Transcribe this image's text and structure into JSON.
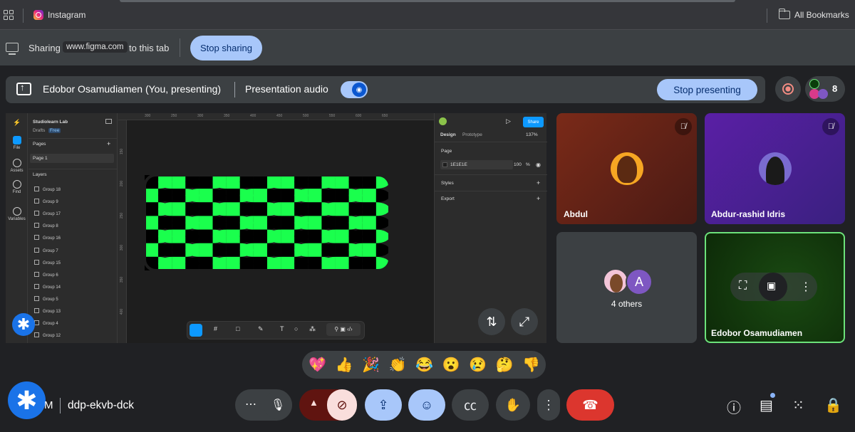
{
  "bookmarks": {
    "instagram": "Instagram",
    "all_bookmarks": "All Bookmarks"
  },
  "sharing": {
    "label": "Sharing",
    "domain": "www.figma.com",
    "suffix": "to this tab",
    "stop_button": "Stop sharing"
  },
  "presenting": {
    "presenter": "Edobor Osamudiamen (You, presenting)",
    "audio_label": "Presentation audio",
    "stop_button": "Stop presenting",
    "people_count": "8"
  },
  "figma": {
    "team": "Studiolearn Lab",
    "drafts": "Drafts",
    "plan": "Free",
    "pages_label": "Pages",
    "page1": "Page 1",
    "layers_label": "Layers",
    "layers": [
      "Group 18",
      "Group 9",
      "Group 17",
      "Group 8",
      "Group 16",
      "Group 7",
      "Group 15",
      "Group 6",
      "Group 14",
      "Group 5",
      "Group 13",
      "Group 4",
      "Group 12"
    ],
    "rail": [
      "File",
      "Assets",
      "Find",
      "Variables"
    ],
    "ruler_top": [
      "300",
      "250",
      "300",
      "350",
      "400",
      "450",
      "500",
      "550",
      "600",
      "650"
    ],
    "ruler_left": [
      "150",
      "200",
      "250",
      "300",
      "350",
      "400"
    ],
    "share": "Share",
    "tab_design": "Design",
    "tab_prototype": "Prototype",
    "zoom": "137%",
    "page_section": "Page",
    "bg_hex": "1E1E1E",
    "bg_opacity": "100",
    "pct": "%",
    "styles": "Styles",
    "export": "Export",
    "pattern_color": "#1aff4d"
  },
  "participants": {
    "abdul": "Abdul",
    "abdur": "Abdur-rashid Idris",
    "others_initial": "A",
    "others_label": "4 others",
    "self": "Edobor Osamudiamen"
  },
  "reactions": [
    "💖",
    "👍",
    "🎉",
    "👏",
    "😂",
    "😮",
    "😢",
    "🤔",
    "👎"
  ],
  "meeting": {
    "initial": "M",
    "code": "ddp-ekvb-dck"
  }
}
